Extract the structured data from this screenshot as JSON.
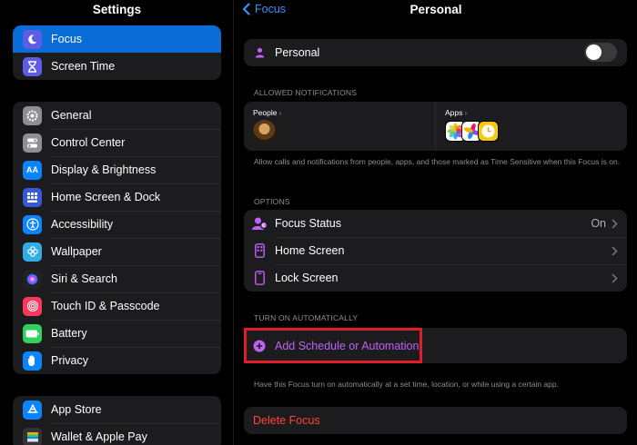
{
  "sidebar": {
    "title": "Settings",
    "group1": [
      {
        "label": "Focus",
        "icon": "moon-icon",
        "color": "#5d5ce6",
        "selected": true
      },
      {
        "label": "Screen Time",
        "icon": "hourglass-icon",
        "color": "#5d5ce6"
      }
    ],
    "group2": [
      {
        "label": "General",
        "icon": "gear-icon",
        "color": "#8e8e93"
      },
      {
        "label": "Control Center",
        "icon": "toggles-icon",
        "color": "#8e8e93"
      },
      {
        "label": "Display & Brightness",
        "icon": "aa-icon",
        "color": "#0a84ff",
        "glyph": "AA"
      },
      {
        "label": "Home Screen & Dock",
        "icon": "grid-icon",
        "color": "#3a57d6"
      },
      {
        "label": "Accessibility",
        "icon": "accessibility-icon",
        "color": "#0a84ff"
      },
      {
        "label": "Wallpaper",
        "icon": "flower-icon",
        "color": "#32ade6"
      },
      {
        "label": "Siri & Search",
        "icon": "siri-icon",
        "color": "#222"
      },
      {
        "label": "Touch ID & Passcode",
        "icon": "fingerprint-icon",
        "color": "#ff375f"
      },
      {
        "label": "Battery",
        "icon": "battery-icon",
        "color": "#30d158"
      },
      {
        "label": "Privacy",
        "icon": "hand-icon",
        "color": "#0a84ff"
      }
    ],
    "group3": [
      {
        "label": "App Store",
        "icon": "app-store-icon",
        "color": "#0a84ff"
      },
      {
        "label": "Wallet & Apple Pay",
        "icon": "wallet-icon",
        "color": "#333"
      }
    ]
  },
  "nav": {
    "back_label": "Focus",
    "title": "Personal"
  },
  "personal": {
    "label": "Personal",
    "toggle_on": false
  },
  "allowed": {
    "section_label": "ALLOWED NOTIFICATIONS",
    "people_label": "People",
    "apps_label": "Apps",
    "footnote": "Allow calls and notifications from people, apps, and those marked as Time Sensitive when this Focus is on."
  },
  "options": {
    "section_label": "OPTIONS",
    "rows": [
      {
        "label": "Focus Status",
        "value": "On"
      },
      {
        "label": "Home Screen",
        "value": ""
      },
      {
        "label": "Lock Screen",
        "value": ""
      }
    ]
  },
  "automation": {
    "section_label": "TURN ON AUTOMATICALLY",
    "add_label": "Add Schedule or Automation",
    "footnote": "Have this Focus turn on automatically at a set time, location, or while using a certain app."
  },
  "delete_label": "Delete Focus",
  "colors": {
    "accent": "#3b8ff7",
    "purple": "#c061f6",
    "delete": "#ff453a",
    "highlight": "#e01e2a",
    "selected": "#0a6cd6"
  }
}
